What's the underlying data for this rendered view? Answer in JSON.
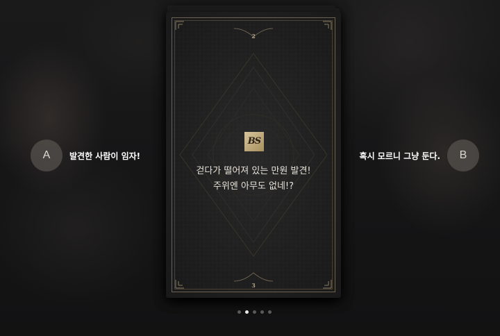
{
  "card": {
    "number_top": "2",
    "number_bottom": "3",
    "logo_text": "BS",
    "text_line1": "걷다가 떨어져 있는 만원 발견!",
    "text_line2": "주위엔 아무도 없네!?"
  },
  "choices": [
    {
      "letter": "A",
      "label": "발견한 사람이 임자!"
    },
    {
      "letter": "B",
      "label": "혹시 모르니 그냥 둔다."
    }
  ],
  "pagination": {
    "total": 5,
    "active_index": 1
  },
  "colors": {
    "card_border": "#6d6252",
    "card_number": "#b3a58c",
    "logo_gold": "#c9b27f",
    "dot_active": "#e8e8e8",
    "dot_inactive": "#5a5a5a"
  }
}
